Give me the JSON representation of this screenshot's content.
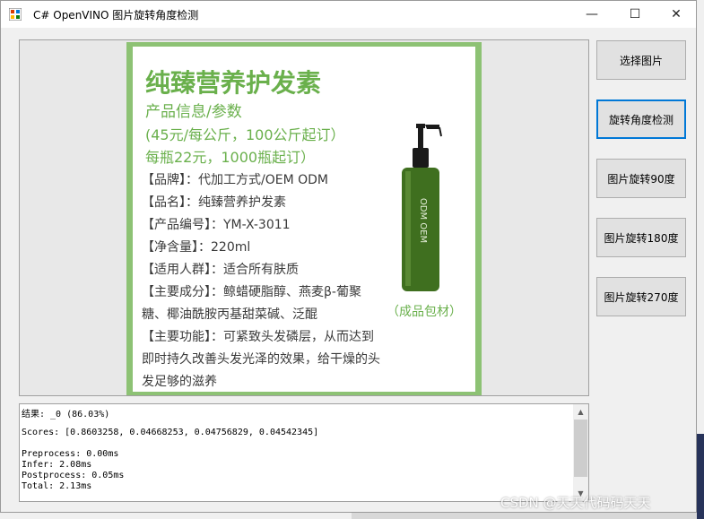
{
  "window": {
    "title": "C# OpenVINO 图片旋转角度检测",
    "controls": {
      "minimize": "—",
      "maximize": "☐",
      "close": "✕"
    }
  },
  "image": {
    "title": "纯臻营养护发素",
    "subtitle": "产品信息/参数",
    "price1": "(45元/每公斤，100公斤起订）",
    "price2": "每瓶22元，1000瓶起订）",
    "lines": [
      "【品牌】：代加工方式/OEM ODM",
      "【品名】：纯臻营养护发素",
      "【产品编号】：YM-X-3011",
      "【净含量】：220ml",
      "【适用人群】：适合所有肤质",
      "【主要成分】：鲸蜡硬脂醇、燕麦β-葡聚",
      "糖、椰油酰胺丙基甜菜碱、泛醌",
      "【主要功能】：可紧致头发磷层，从而达到",
      "即时持久改善头发光泽的效果，给干燥的头",
      "发足够的滋养"
    ],
    "bottle_label": "ODM OEM",
    "caption": "（成品包材）"
  },
  "buttons": {
    "select_image": "选择图片",
    "detect_rotation": "旋转角度检测",
    "rotate_90": "图片旋转90度",
    "rotate_180": "图片旋转180度",
    "rotate_270": "图片旋转270度"
  },
  "output": {
    "result": "结果: _0 (86.03%)",
    "scores": "Scores: [0.8603258, 0.04668253, 0.04756829, 0.04542345]",
    "preprocess": "Preprocess: 0.00ms",
    "infer": "Infer: 2.08ms",
    "postprocess": "Postprocess: 0.05ms",
    "total": "Total: 2.13ms"
  },
  "watermark": "CSDN @天天代码码天天",
  "colors": {
    "accent": "#0078d7",
    "product_green": "#6ab04c",
    "border_green": "#8dc274"
  }
}
